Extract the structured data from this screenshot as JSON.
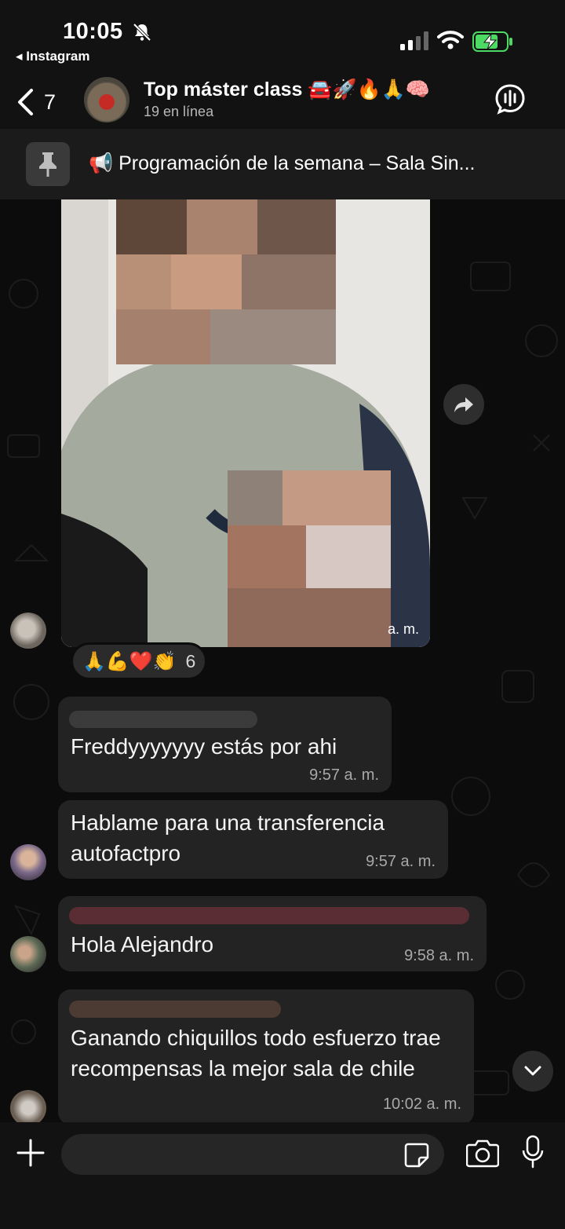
{
  "status": {
    "time": "10:05",
    "back_app": "◂ Instagram",
    "icons": [
      "bell-slash-icon",
      "signal-icon",
      "wifi-icon",
      "battery-charging-icon"
    ]
  },
  "header": {
    "back_count": "7",
    "title": "Top  máster class 🚘🚀🔥🙏🧠",
    "subtitle": "19 en línea",
    "icons": [
      "chevron-left-icon",
      "audio-chat-icon"
    ]
  },
  "pinned": {
    "text": "📢 Programación de la semana – Sala Sin..."
  },
  "messages": {
    "photo": {
      "time": "a. m.",
      "reactions": "🙏💪❤️👏",
      "reaction_count": "6"
    },
    "m1": {
      "text": "Freddyyyyyyy estás por ahi",
      "time": "9:57 a. m."
    },
    "m2": {
      "text": "Hablame para una transferencia autofactpro",
      "time": "9:57 a. m."
    },
    "m3": {
      "text": "Hola Alejandro",
      "time": "9:58 a. m."
    },
    "m4": {
      "text": "Ganando chiquillos todo esfuerzo trae recompensas la mejor sala de chile",
      "time": "10:02 a. m."
    }
  },
  "composer": {
    "placeholder": "",
    "icons": [
      "plus-icon",
      "sticker-icon",
      "camera-icon",
      "microphone-icon"
    ]
  },
  "colors": {
    "bubble": "#232323",
    "chat_bg": "#0c0c0c",
    "battery_green": "#4cd964"
  }
}
